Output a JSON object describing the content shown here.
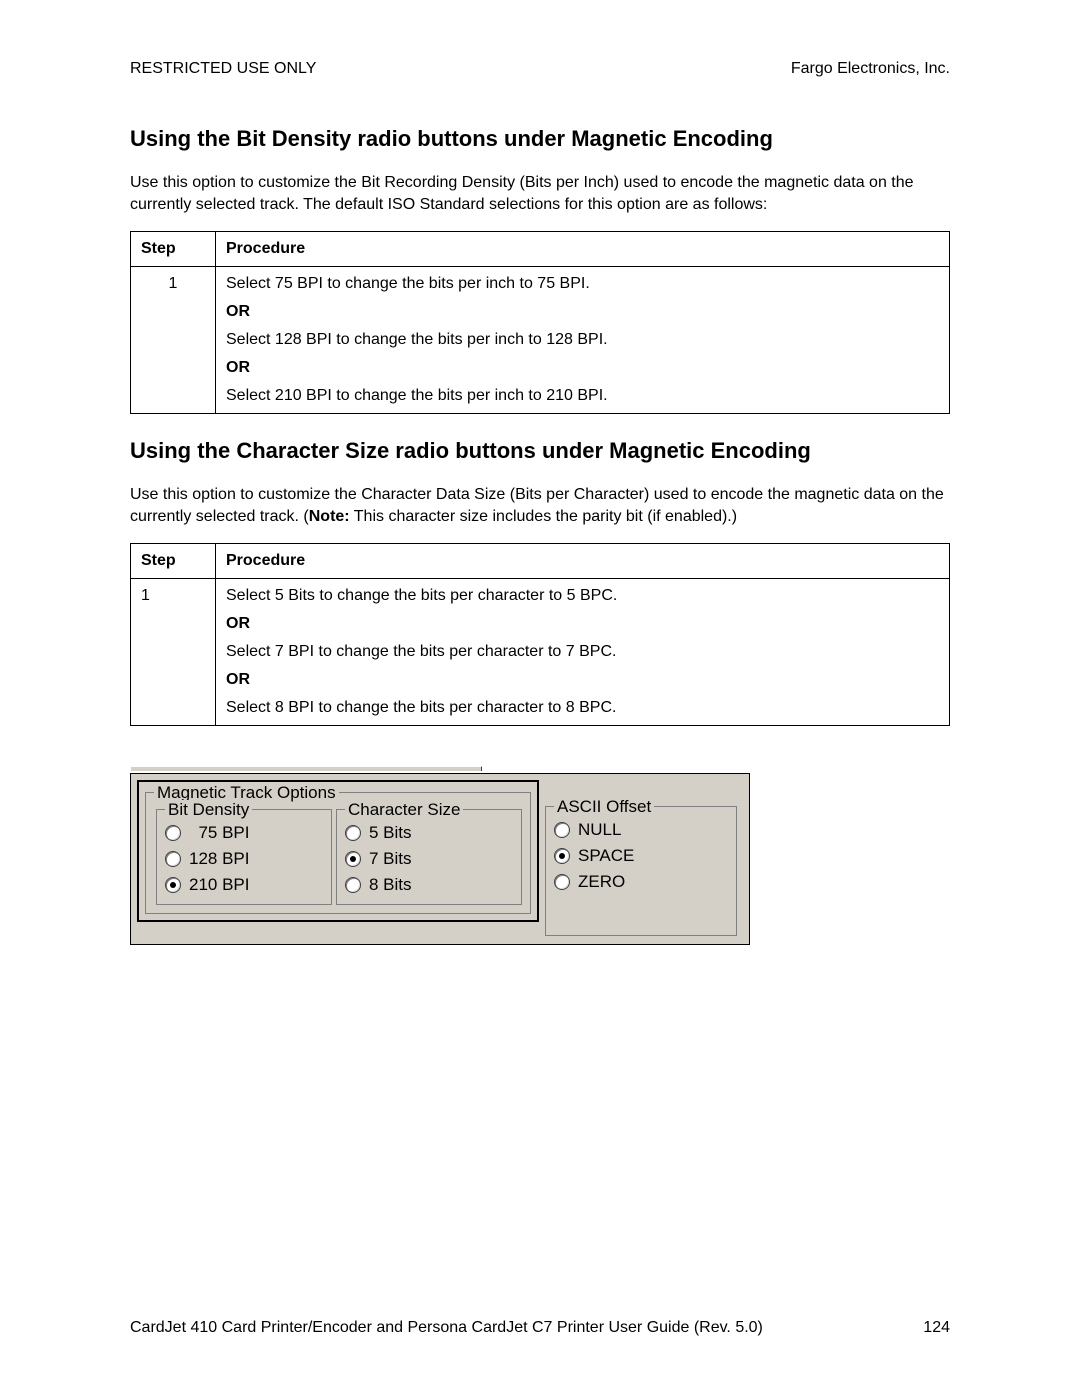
{
  "header": {
    "left": "RESTRICTED USE ONLY",
    "right": "Fargo Electronics, Inc."
  },
  "section1": {
    "title": "Using the Bit Density radio buttons under Magnetic Encoding",
    "intro": "Use this option to customize the Bit Recording Density (Bits per Inch) used to encode the magnetic data on the currently selected track. The default ISO Standard selections for this option are as follows:",
    "th_step": "Step",
    "th_proc": "Procedure",
    "step": "1",
    "p1": "Select 75 BPI to change the bits per inch to 75 BPI.",
    "or": "OR",
    "p2": "Select 128 BPI to change the bits per inch to 128 BPI.",
    "p3": "Select 210 BPI to change the bits per inch to 210 BPI."
  },
  "section2": {
    "title": "Using the Character Size radio buttons under Magnetic Encoding",
    "intro_a": "Use this option to customize the Character Data Size (Bits per Character) used to encode the magnetic data on the currently selected track. (",
    "intro_note_label": "Note:",
    "intro_b": "  This character size includes the parity bit (if enabled).)",
    "th_step": "Step",
    "th_proc": "Procedure",
    "step": "1",
    "p1": "Select 5 Bits to change the bits per character to 5 BPC.",
    "or": "OR",
    "p2": "Select 7 BPI to change the bits per character to 7 BPC.",
    "p3": "Select 8 BPI to change the bits per character to 8 BPC."
  },
  "dialog": {
    "title": "Magnetic Track Options",
    "bit_density": {
      "label": "Bit Density",
      "o1": "  75 BPI",
      "o2": "128 BPI",
      "o3": "210 BPI",
      "selected": 3
    },
    "char_size": {
      "label": "Character Size",
      "o1": "5 Bits",
      "o2": "7 Bits",
      "o3": "8 Bits",
      "selected": 2
    },
    "ascii": {
      "label": "ASCII Offset",
      "o1": "NULL",
      "o2": "SPACE",
      "o3": "ZERO",
      "selected": 2
    }
  },
  "footer": {
    "text": "CardJet 410 Card Printer/Encoder and Persona CardJet C7 Printer User Guide (Rev. 5.0)",
    "page": "124"
  }
}
